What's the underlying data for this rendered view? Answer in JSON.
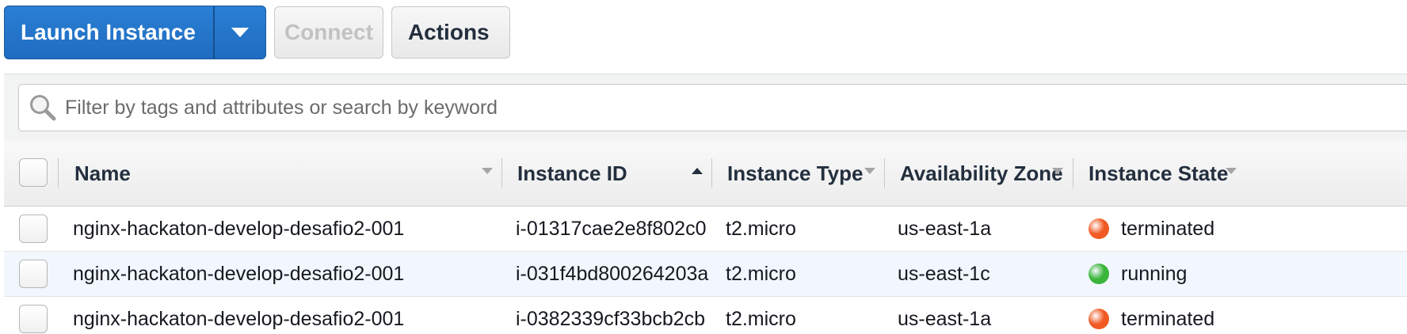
{
  "toolbar": {
    "launch_label": "Launch Instance",
    "connect_label": "Connect",
    "actions_label": "Actions"
  },
  "filter": {
    "placeholder": "Filter by tags and attributes or search by keyword"
  },
  "table": {
    "columns": {
      "name": "Name",
      "instance_id": "Instance ID",
      "instance_type": "Instance Type",
      "availability_zone": "Availability Zone",
      "instance_state": "Instance State"
    },
    "rows": [
      {
        "name": "nginx-hackaton-develop-desafio2-001",
        "instance_id": "i-01317cae2e8f802c0",
        "instance_type": "t2.micro",
        "availability_zone": "us-east-1a",
        "state": "terminated",
        "state_color": "#f15a24"
      },
      {
        "name": "nginx-hackaton-develop-desafio2-001",
        "instance_id": "i-031f4bd800264203a",
        "instance_type": "t2.micro",
        "availability_zone": "us-east-1c",
        "state": "running",
        "state_color": "#3ab53a"
      },
      {
        "name": "nginx-hackaton-develop-desafio2-001",
        "instance_id": "i-0382339cf33bcb2cb",
        "instance_type": "t2.micro",
        "availability_zone": "us-east-1a",
        "state": "terminated",
        "state_color": "#f15a24"
      }
    ]
  },
  "colors": {
    "primary_button": "#1f6cc1",
    "running": "#3ab53a",
    "terminated": "#f15a24",
    "selected_row": "#f1f7fd"
  }
}
